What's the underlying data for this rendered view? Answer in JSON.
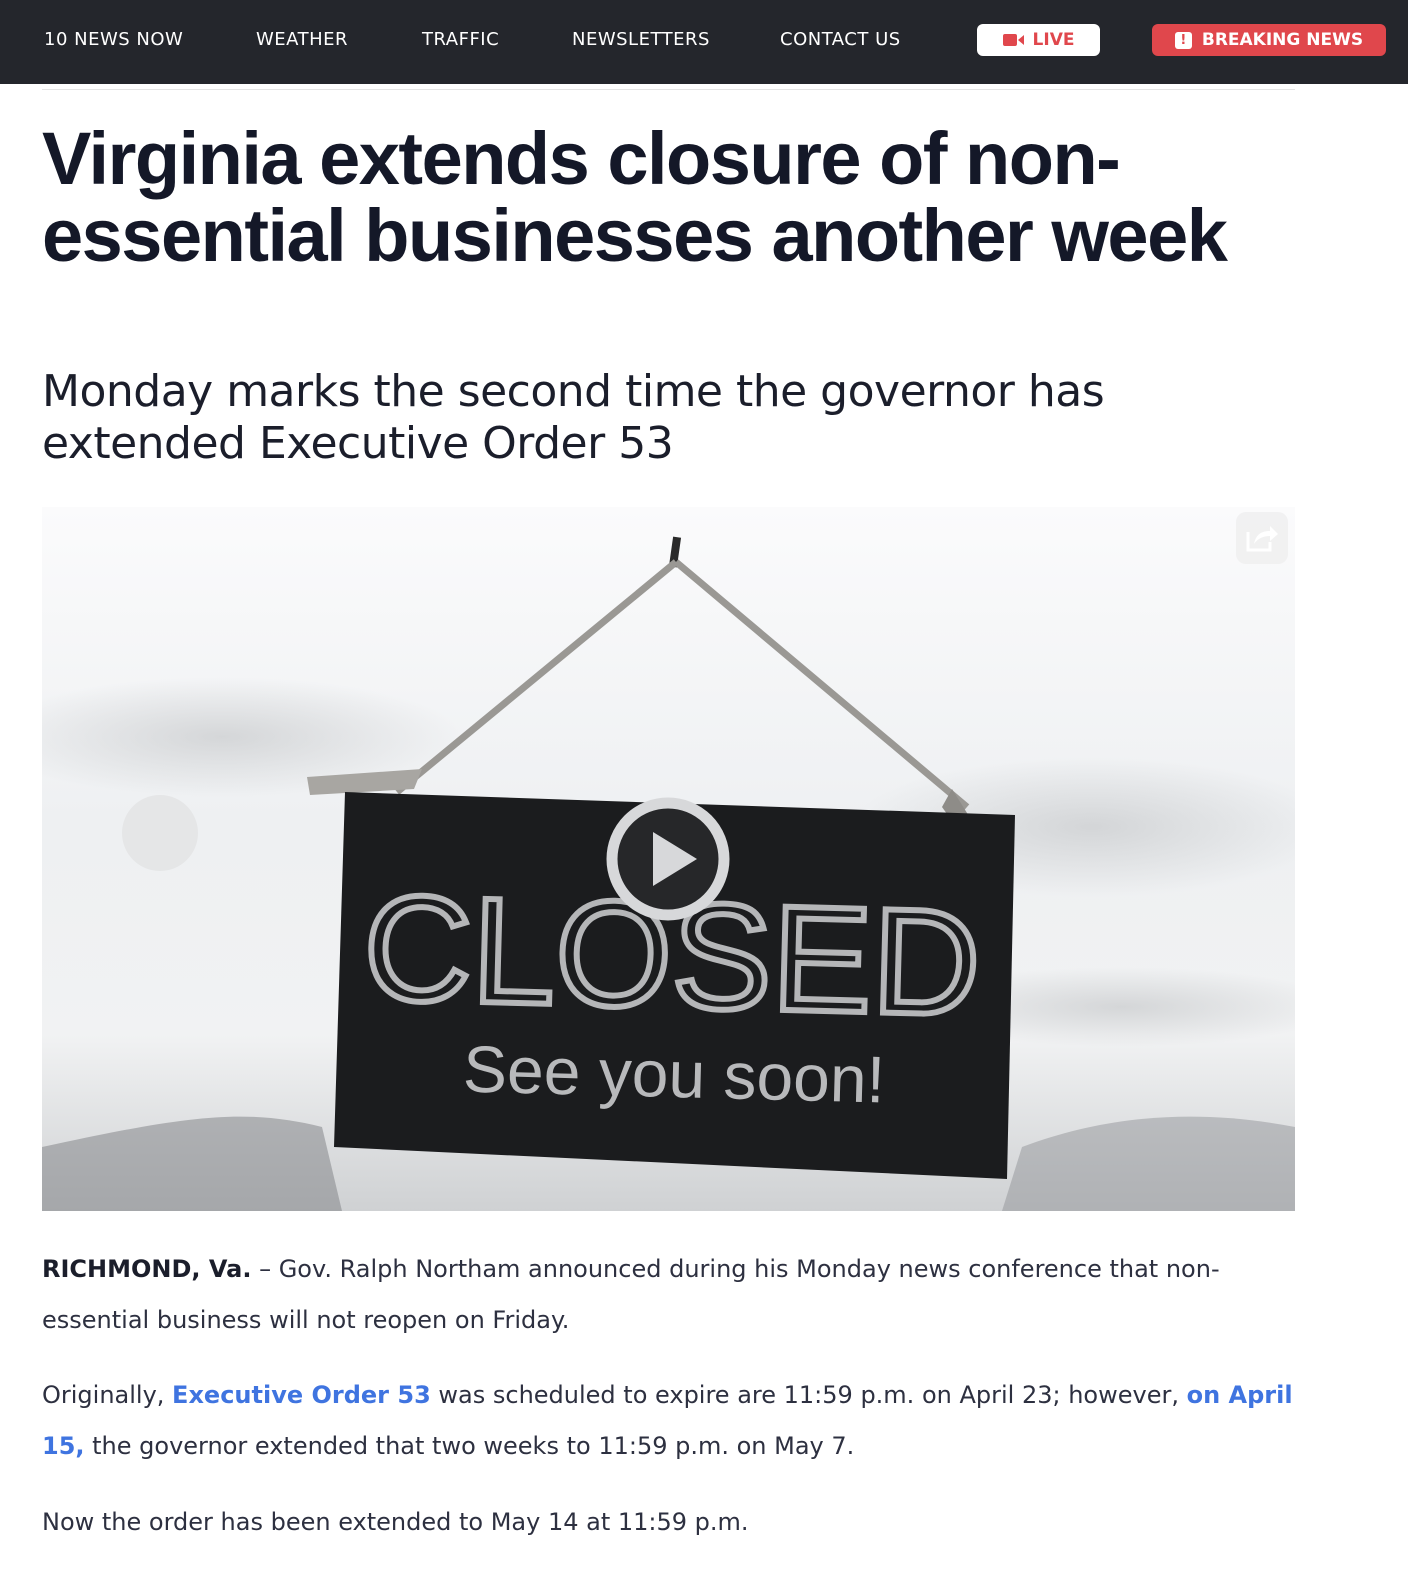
{
  "nav": {
    "items": [
      "10 NEWS NOW",
      "WEATHER",
      "TRAFFIC",
      "NEWSLETTERS",
      "CONTACT US"
    ],
    "live_label": "LIVE",
    "breaking_label": "BREAKING NEWS",
    "breaking_badge": "!"
  },
  "article": {
    "headline": "Virginia extends closure of non-essential businesses another week",
    "subheadline": "Monday marks the second time the governor has extended Executive Order 53",
    "video": {
      "sign_text": "CLOSED",
      "sign_subtext": "See you soon!"
    },
    "paragraphs": {
      "p1": {
        "dateline": "RICHMOND, Va.",
        "text": " – Gov. Ralph Northam announced during his Monday news conference that non-essential business will not reopen on Friday."
      },
      "p2": {
        "before": "Originally, ",
        "link1": "Executive Order 53",
        "middle": " was scheduled to expire are 11:59 p.m. on April 23; however, ",
        "link2": "on April 15,",
        "after": " the governor extended that two weeks to 11:59 p.m. on May 7."
      },
      "p3": {
        "text": "Now the order has been extended to May 14 at 11:59 p.m."
      }
    }
  },
  "colors": {
    "nav_bg": "#24262c",
    "accent_red": "#e0474c",
    "link_blue": "#3f74e0",
    "headline": "#141828"
  },
  "icons": {
    "live": "video-camera-icon",
    "breaking": "alert-icon",
    "share": "share-icon",
    "play": "play-icon"
  }
}
